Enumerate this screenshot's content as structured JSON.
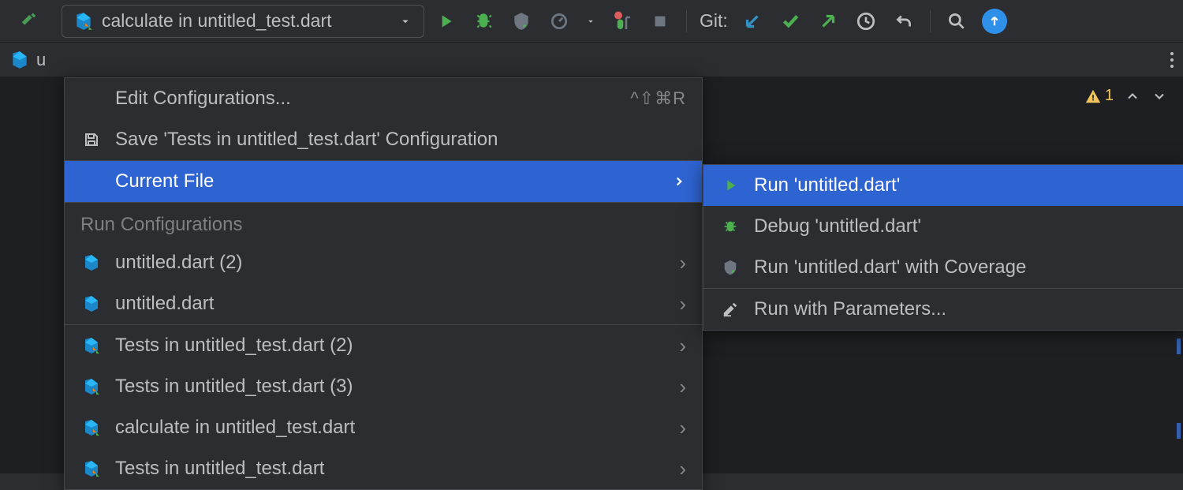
{
  "toolbar": {
    "run_config_label": "calculate in untitled_test.dart",
    "git_label": "Git:"
  },
  "warnings": {
    "count": "1"
  },
  "menu": {
    "edit_configs": "Edit Configurations...",
    "edit_shortcut": "^⇧⌘R",
    "save_config": "Save 'Tests in untitled_test.dart' Configuration",
    "current_file": "Current File",
    "section_header": "Run Configurations",
    "items": [
      "untitled.dart (2)",
      "untitled.dart",
      "Tests in untitled_test.dart (2)",
      "Tests in untitled_test.dart (3)",
      "calculate in untitled_test.dart",
      "Tests in untitled_test.dart"
    ]
  },
  "submenu": {
    "run": "Run 'untitled.dart'",
    "debug": "Debug 'untitled.dart'",
    "coverage": "Run 'untitled.dart' with Coverage",
    "params": "Run with Parameters..."
  }
}
